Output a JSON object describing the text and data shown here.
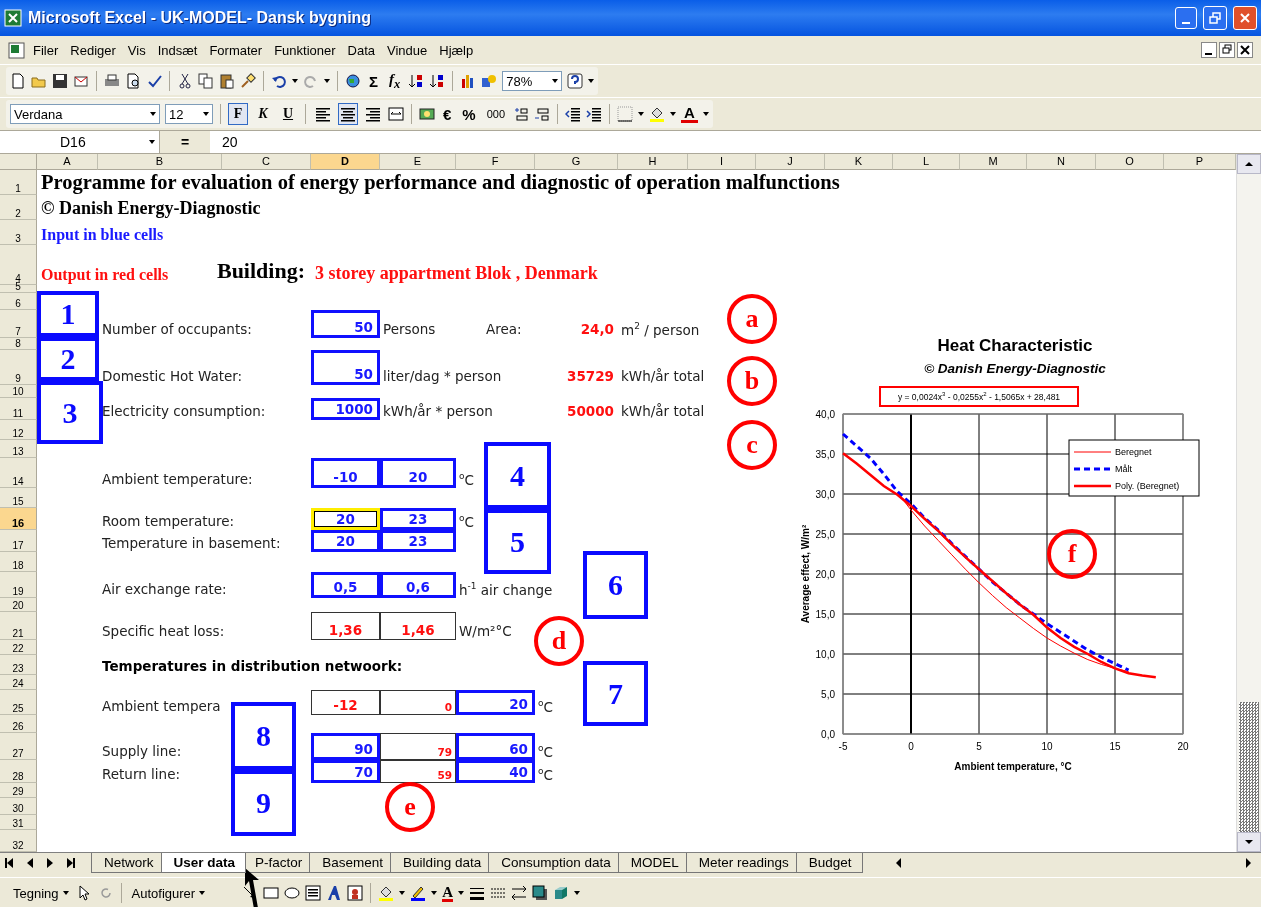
{
  "window": {
    "title": "Microsoft Excel - UK-MODEL- Dansk bygning"
  },
  "menu_bar": [
    "Filer",
    "Rediger",
    "Vis",
    "Indsæt",
    "Formater",
    "Funktioner",
    "Data",
    "Vindue",
    "Hjælp"
  ],
  "standard_toolbar": {
    "sum": "Σ",
    "function": "f$_{x}$",
    "zoom": "78%"
  },
  "formatting_toolbar": {
    "font": "Verdana",
    "size": "12",
    "style_buttons": [
      {
        "label": "F",
        "pressed": true
      },
      {
        "label": "K",
        "pressed": false
      },
      {
        "label": "U",
        "pressed": false
      }
    ],
    "align_buttons": [
      {
        "pressed": false
      },
      {
        "pressed": true
      },
      {
        "pressed": false
      }
    ],
    "euro": "€",
    "percent": "%",
    "thousands": "000",
    "font_color": "A"
  },
  "formula_bar": {
    "name_box": "D16",
    "equals": "=",
    "value": "20"
  },
  "columns": [
    {
      "label": "A",
      "selected": false
    },
    {
      "label": "B",
      "selected": false
    },
    {
      "label": "C",
      "selected": false
    },
    {
      "label": "D",
      "selected": true
    },
    {
      "label": "E",
      "selected": false
    },
    {
      "label": "F",
      "selected": false
    },
    {
      "label": "G",
      "selected": false
    },
    {
      "label": "H",
      "selected": false
    },
    {
      "label": "I",
      "selected": false
    },
    {
      "label": "J",
      "selected": false
    },
    {
      "label": "K",
      "selected": false
    },
    {
      "label": "L",
      "selected": false
    },
    {
      "label": "M",
      "selected": false
    },
    {
      "label": "N",
      "selected": false
    },
    {
      "label": "O",
      "selected": false
    },
    {
      "label": "P",
      "selected": false
    }
  ],
  "rows": [
    {
      "number": "1",
      "selected": false,
      "cells": [
        {
          "kind": "title",
          "text": "Programme for evaluation of energy performance and diagnostic of operation malfunctions"
        }
      ]
    },
    {
      "number": "2",
      "selected": false,
      "cells": [
        {
          "kind": "subtitle",
          "text": "©  Danish Energy-Diagnostic"
        }
      ]
    },
    {
      "number": "3",
      "selected": false,
      "cells": [
        {
          "kind": "input-note",
          "text": "Input in blue cells"
        }
      ]
    },
    {
      "number": "4",
      "selected": false,
      "cells": [
        {
          "kind": "output-note",
          "text": "Output in red cells"
        },
        {
          "kind": "building-label",
          "text": "Building:"
        },
        {
          "kind": "building-name",
          "text": "3 storey appartment Blok , Denmark"
        }
      ]
    },
    {
      "number": "5",
      "selected": false
    },
    {
      "number": "6",
      "selected": false
    },
    {
      "number": "7",
      "selected": false,
      "cells": [
        {
          "kind": "label",
          "text": "Number of occupants:"
        },
        {
          "kind": "input",
          "text": "50",
          "active": false
        },
        {
          "kind": "unit",
          "text": "Persons"
        },
        {
          "kind": "caption",
          "text": "Area:"
        },
        {
          "kind": "total",
          "text": "24,0"
        },
        {
          "kind": "total-unit",
          "text": "m$^{2}$ / person"
        }
      ]
    },
    {
      "number": "8",
      "selected": false
    },
    {
      "number": "9",
      "selected": false,
      "cells": [
        {
          "kind": "label",
          "text": "Domestic Hot Water:"
        },
        {
          "kind": "input",
          "text": "50",
          "active": false
        },
        {
          "kind": "unit",
          "text": "liter/dag * person"
        },
        {
          "kind": "total",
          "text": "35729"
        },
        {
          "kind": "total-unit",
          "text": "kWh/år total"
        }
      ]
    },
    {
      "number": "10",
      "selected": false
    },
    {
      "number": "11",
      "selected": false,
      "cells": [
        {
          "kind": "label",
          "text": "Electricity consumption:"
        },
        {
          "kind": "input",
          "text": "1000",
          "active": false
        },
        {
          "kind": "unit",
          "text": "kWh/år * person"
        },
        {
          "kind": "total",
          "text": "50000"
        },
        {
          "kind": "total-unit",
          "text": "kWh/år total"
        }
      ]
    },
    {
      "number": "12",
      "selected": false
    },
    {
      "number": "13",
      "selected": false
    },
    {
      "number": "14",
      "selected": false,
      "cells": [
        {
          "kind": "label",
          "text": "Ambient temperature:"
        },
        {
          "kind": "setpoint",
          "text": "-10",
          "active": false
        },
        {
          "kind": "setpoint",
          "text": "20",
          "active": false
        },
        {
          "kind": "unit",
          "text": "$^{o}$C"
        }
      ]
    },
    {
      "number": "15",
      "selected": false
    },
    {
      "number": "16",
      "selected": true,
      "cells": [
        {
          "kind": "label",
          "text": "Room temperature:"
        },
        {
          "kind": "setpoint",
          "text": "20",
          "active": true
        },
        {
          "kind": "setpoint",
          "text": "23",
          "active": false
        },
        {
          "kind": "unit",
          "text": "$^{o}$C"
        }
      ]
    },
    {
      "number": "17",
      "selected": false,
      "cells": [
        {
          "kind": "label",
          "text": "Temperature in basement:"
        },
        {
          "kind": "setpoint",
          "text": "20",
          "active": false
        },
        {
          "kind": "setpoint",
          "text": "23",
          "active": false
        }
      ]
    },
    {
      "number": "18",
      "selected": false
    },
    {
      "number": "19",
      "selected": false,
      "cells": [
        {
          "kind": "label",
          "text": "Air exchange rate:"
        },
        {
          "kind": "setpoint",
          "text": "0,5",
          "active": false
        },
        {
          "kind": "setpoint",
          "text": "0,6",
          "active": false
        },
        {
          "kind": "unit",
          "text": "h$^{-1}$ air change"
        }
      ]
    },
    {
      "number": "20",
      "selected": false
    },
    {
      "number": "21",
      "selected": false,
      "cells": [
        {
          "kind": "label",
          "text": "Specific heat loss:"
        },
        {
          "kind": "result",
          "text": "1,36"
        },
        {
          "kind": "result",
          "text": "1,46"
        },
        {
          "kind": "unit",
          "text": "W/m²°C"
        }
      ]
    },
    {
      "number": "22",
      "selected": false
    },
    {
      "number": "23",
      "selected": false,
      "cells": [
        {
          "kind": "heading",
          "text": "Temperatures in distribution netwoork:"
        }
      ]
    },
    {
      "number": "24",
      "selected": false
    },
    {
      "number": "25",
      "selected": false,
      "cells": [
        {
          "kind": "label",
          "text": "Ambient tempera"
        },
        {
          "kind": "result",
          "text": "-12"
        },
        {
          "kind": "small-result",
          "text": "0"
        },
        {
          "kind": "input",
          "text": "20",
          "active": false
        },
        {
          "kind": "unit",
          "text": "$^{o}$C"
        }
      ]
    },
    {
      "number": "26",
      "selected": false
    },
    {
      "number": "27",
      "selected": false,
      "cells": [
        {
          "kind": "label",
          "text": "Supply line:"
        },
        {
          "kind": "input",
          "text": "90",
          "active": false
        },
        {
          "kind": "small-result",
          "text": "79"
        },
        {
          "kind": "input",
          "text": "60",
          "active": false
        },
        {
          "kind": "unit",
          "text": "$^{o}$C"
        }
      ]
    },
    {
      "number": "28",
      "selected": false,
      "cells": [
        {
          "kind": "label",
          "text": "Return line:"
        },
        {
          "kind": "input",
          "text": "70",
          "active": false
        },
        {
          "kind": "small-result",
          "text": "59"
        },
        {
          "kind": "input",
          "text": "40",
          "active": false
        },
        {
          "kind": "unit",
          "text": "$^{o}$C"
        }
      ]
    },
    {
      "number": "29",
      "selected": false
    },
    {
      "number": "30",
      "selected": false
    },
    {
      "number": "31",
      "selected": false
    },
    {
      "number": "32",
      "selected": false
    }
  ],
  "annotations": {
    "boxes": [
      "1",
      "2",
      "3",
      "4",
      "5",
      "6",
      "7",
      "8",
      "9"
    ],
    "circles": [
      "a",
      "b",
      "c",
      "d",
      "e",
      "f"
    ]
  },
  "chart": {
    "title": "Heat Characteristic",
    "subtitle": "©  Danish Energy-Diagnostic",
    "equation": "y = 0,0024x$^{3}$ - 0,0255x$^{2}$ - 1,5065x + 28,481",
    "chart_data": {
      "type": "line",
      "grid": true,
      "legend": true,
      "xlabel": "Ambient temperature, °C",
      "ylabel": "Average effect, W/m²",
      "x": [
        -5,
        -4,
        -3,
        -2,
        -1,
        0,
        1,
        2,
        3,
        4,
        5,
        6,
        7,
        8,
        9,
        10,
        11,
        12,
        13,
        14,
        15,
        16,
        17,
        18
      ],
      "series": [
        {
          "name": "Beregnet",
          "color": "#ff0000",
          "line_style": "solid",
          "values": [
            null,
            null,
            null,
            null,
            30.2,
            28,
            26,
            24.2,
            22.4,
            20.6,
            18.9,
            17.3,
            15.8,
            14.5,
            13.2,
            12,
            11,
            10.1,
            9.3,
            8.7,
            8.2,
            7.8,
            null,
            null
          ]
        },
        {
          "name": "Målt",
          "color": "#0000ff",
          "line_style": "dashed",
          "values": [
            37.5,
            36,
            34.5,
            32.5,
            30.3,
            28.8,
            27,
            25.5,
            23.8,
            22.2,
            20.6,
            19,
            17.6,
            16.2,
            15,
            13.8,
            12.7,
            11.6,
            10.5,
            9.6,
            8.8,
            8,
            null,
            null
          ]
        },
        {
          "name": "Poly. (Beregnet)",
          "color": "#ff0000",
          "line_style": "solid",
          "values": [
            35.1,
            33.8,
            32.4,
            31,
            29.9,
            28.5,
            26.9,
            25.4,
            23.7,
            22.1,
            20.6,
            19.1,
            17.6,
            16.2,
            14.9,
            13.3,
            12,
            10.9,
            10,
            9,
            8.2,
            7.6,
            7.3,
            7.1
          ]
        }
      ],
      "xlim": [
        -5,
        20
      ],
      "ylim": [
        0,
        40
      ],
      "xticks": [
        -5,
        0,
        5,
        10,
        15,
        20
      ],
      "yticks": [
        {
          "value": 0,
          "label": "0,0"
        },
        {
          "value": 5,
          "label": "5,0"
        },
        {
          "value": 10,
          "label": "10,0"
        },
        {
          "value": 15,
          "label": "15,0"
        },
        {
          "value": 20,
          "label": "20,0"
        },
        {
          "value": 25,
          "label": "25,0"
        },
        {
          "value": 30,
          "label": "30,0"
        },
        {
          "value": 35,
          "label": "35,0"
        },
        {
          "value": 40,
          "label": "40,0"
        }
      ]
    }
  },
  "sheet_tabs": [
    {
      "label": "Network",
      "selected": false
    },
    {
      "label": "User data",
      "selected": true
    },
    {
      "label": "P-factor",
      "selected": false
    },
    {
      "label": "Basement",
      "selected": false
    },
    {
      "label": "Building data",
      "selected": false
    },
    {
      "label": "Consumption data",
      "selected": false
    },
    {
      "label": "MODEL",
      "selected": false
    },
    {
      "label": "Meter readings",
      "selected": false
    },
    {
      "label": "Budget",
      "selected": false
    }
  ],
  "drawing_toolbar": {
    "draw_menu": "Tegning",
    "autoshapes_menu": "Autofigurer",
    "font_color": "A"
  }
}
